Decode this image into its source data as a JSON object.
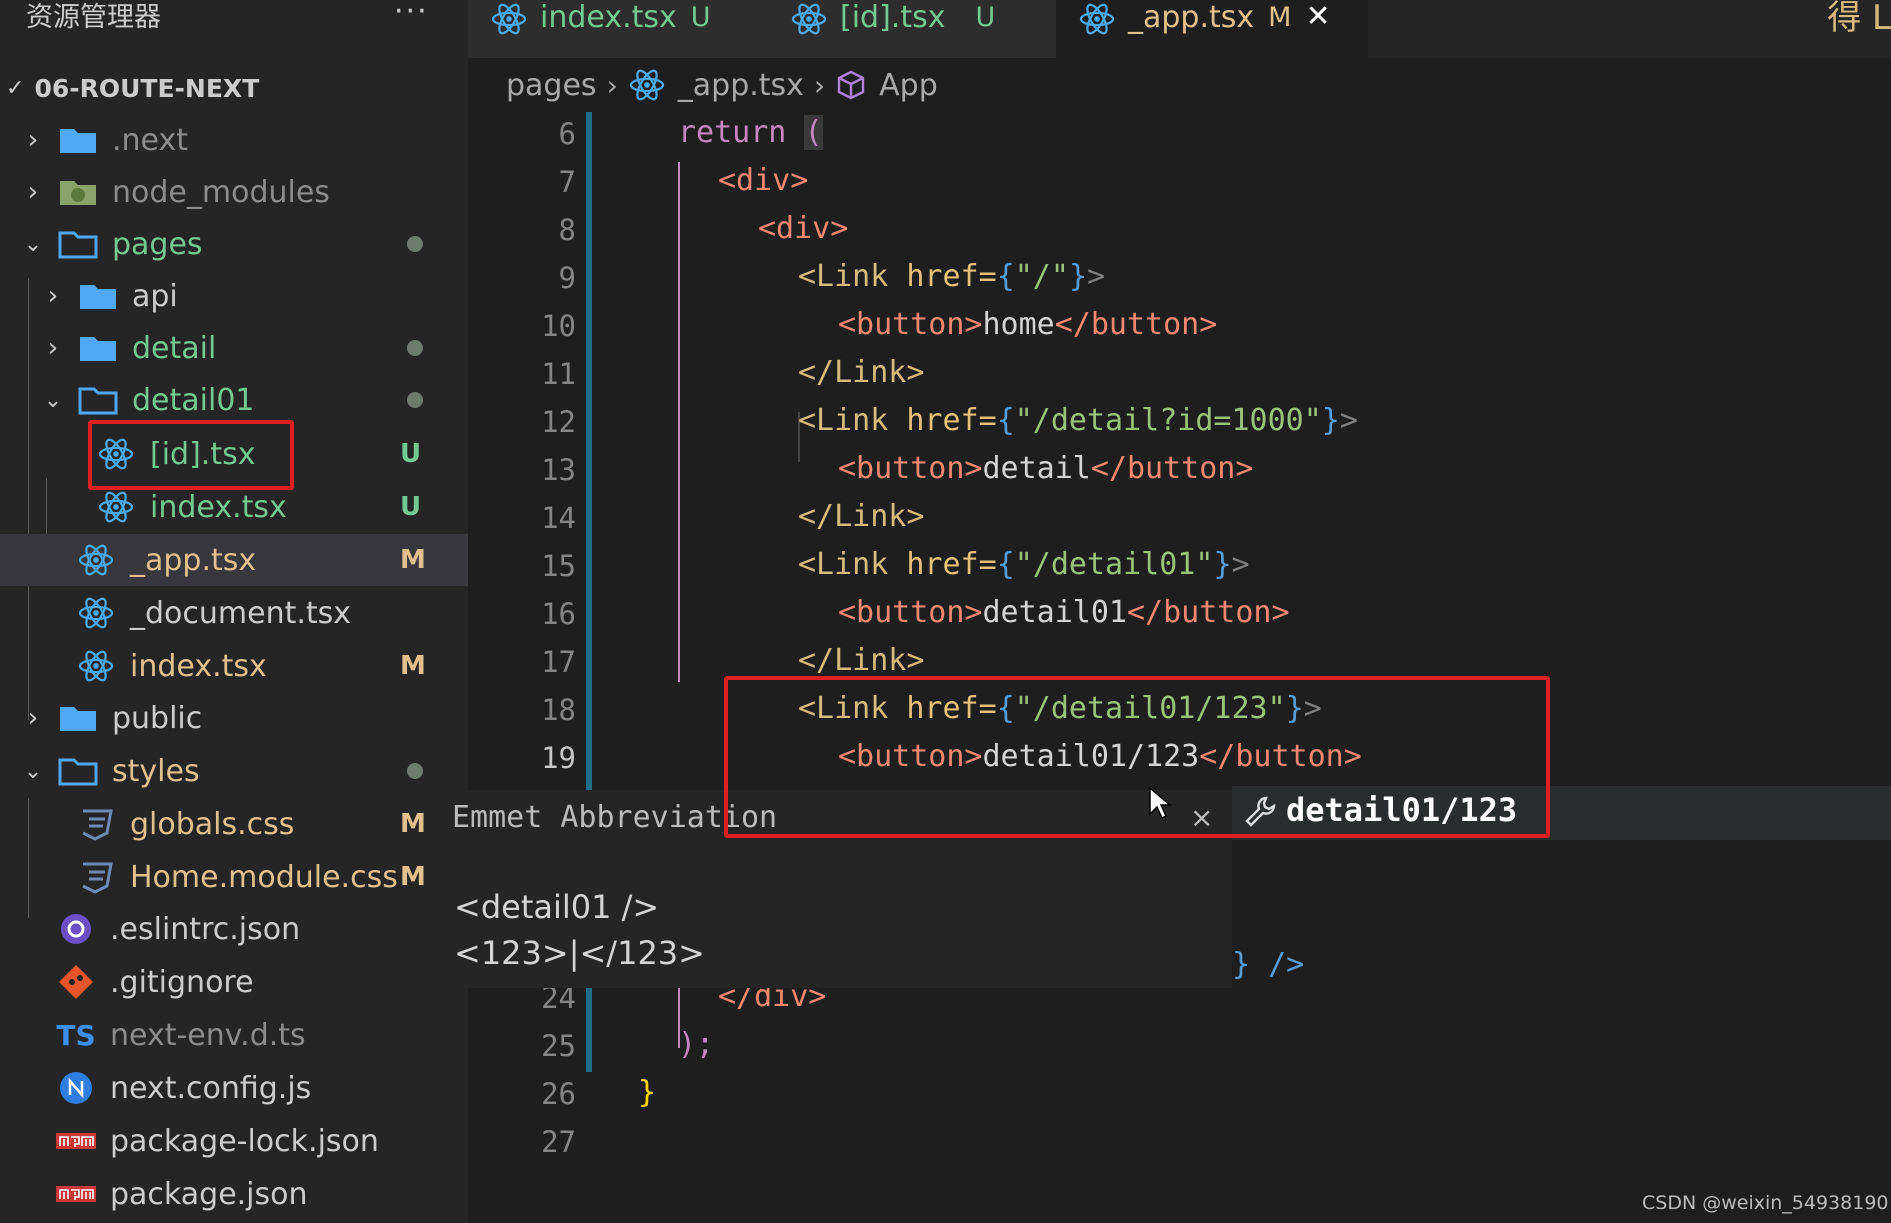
{
  "explorer": {
    "title": "资源管理器",
    "more": "···"
  },
  "tabs": [
    {
      "name": "index.tsx",
      "badge": "U"
    },
    {
      "name": "[id].tsx",
      "badge": "U"
    },
    {
      "name": "_app.tsx",
      "badge": "M",
      "close": "✕"
    }
  ],
  "corner_text": "得 L",
  "project": {
    "name": "06-ROUTE-NEXT"
  },
  "tree": [
    {
      "name": ".next",
      "badge": ""
    },
    {
      "name": "node_modules",
      "badge": ""
    },
    {
      "name": "pages",
      "badge": ""
    },
    {
      "name": "api",
      "badge": ""
    },
    {
      "name": "detail",
      "badge": ""
    },
    {
      "name": "detail01",
      "badge": ""
    },
    {
      "name": "[id].tsx",
      "badge": "U"
    },
    {
      "name": "index.tsx",
      "badge": "U"
    },
    {
      "name": "_app.tsx",
      "badge": "M"
    },
    {
      "name": "_document.tsx",
      "badge": ""
    },
    {
      "name": "index.tsx",
      "badge": "M"
    },
    {
      "name": "public",
      "badge": ""
    },
    {
      "name": "styles",
      "badge": ""
    },
    {
      "name": "globals.css",
      "badge": "M"
    },
    {
      "name": "Home.module.css",
      "badge": "M"
    },
    {
      "name": ".eslintrc.json",
      "badge": ""
    },
    {
      "name": ".gitignore",
      "badge": ""
    },
    {
      "name": "next-env.d.ts",
      "badge": ""
    },
    {
      "name": "next.config.js",
      "badge": ""
    },
    {
      "name": "package-lock.json",
      "badge": ""
    },
    {
      "name": "package.json",
      "badge": ""
    }
  ],
  "breadcrumb": {
    "folder": "pages",
    "file": "_app.tsx",
    "symbol": "App"
  },
  "line_numbers": [
    "6",
    "7",
    "8",
    "9",
    "10",
    "11",
    "12",
    "13",
    "14",
    "15",
    "16",
    "17",
    "18",
    "19",
    "24",
    "25",
    "26",
    "27"
  ],
  "code": {
    "l6_kw": "return",
    "l6_paren": "(",
    "l7": "<div>",
    "l8": "<div>",
    "l9_open": "<Link",
    "l9_attr": "href=",
    "l9_val": "\"/\"",
    "l9_end": ">",
    "l10_open": "<button>",
    "l10_text": "home",
    "l10_close": "</button>",
    "l11": "</Link>",
    "l12_open": "<Link",
    "l12_attr": "href=",
    "l12_val": "\"/detail?id=1000\"",
    "l12_end": ">",
    "l13_open": "<button>",
    "l13_text": "detail",
    "l13_close": "</button>",
    "l14": "</Link>",
    "l15_open": "<Link",
    "l15_attr": "href=",
    "l15_val": "\"/detail01\"",
    "l15_end": ">",
    "l16_open": "<button>",
    "l16_text": "detail01",
    "l16_close": "</button>",
    "l17": "</Link>",
    "l18_open": "<Link",
    "l18_attr": "href=",
    "l18_val": "\"/detail01/123\"",
    "l18_end": ">",
    "l19_open": "<button>",
    "l19_text": "detail01/123",
    "l19_close": "</button>",
    "l23_tail": "} />",
    "l24": "</div>",
    "l25": ");",
    "l26": "}"
  },
  "emmet": {
    "title": "Emmet Abbreviation",
    "close": "×",
    "suggestion": "detail01/123",
    "preview_line1": "<detail01 />",
    "preview_line2": "<123>|</123>"
  },
  "watermark": "CSDN @weixin_54938190",
  "colors": {
    "untracked": "#73c991",
    "modified": "#e2c08d",
    "highlight_box": "#e02020"
  }
}
